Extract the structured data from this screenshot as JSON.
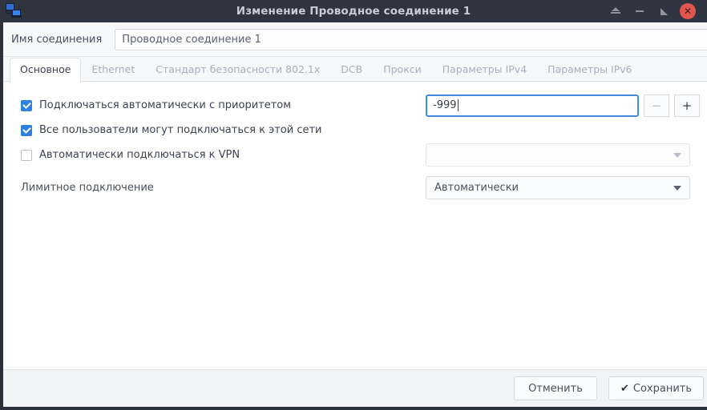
{
  "window": {
    "title": "Изменение Проводное соединение 1",
    "icon": "network-connection-icon",
    "controls": {
      "shade": "shade-icon",
      "minimize": "minimize-icon",
      "maximize": "maximize-icon",
      "close": "✕"
    }
  },
  "name_field": {
    "label": "Имя соединения",
    "value": "Проводное соединение 1",
    "placeholder": "Имя соединения"
  },
  "tabs": [
    {
      "label": "Основное",
      "active": true
    },
    {
      "label": "Ethernet",
      "active": false
    },
    {
      "label": "Стандарт безопасности 802.1x",
      "active": false
    },
    {
      "label": "DCB",
      "active": false
    },
    {
      "label": "Прокси",
      "active": false
    },
    {
      "label": "Параметры IPv4",
      "active": false
    },
    {
      "label": "Параметры IPv6",
      "active": false
    }
  ],
  "form": {
    "autoconnect": {
      "label": "Подключаться автоматически с приоритетом",
      "checked": true,
      "priority_value": "-999",
      "minus_label": "−",
      "plus_label": "+"
    },
    "all_users": {
      "label": "Все пользователи могут подключаться к этой сети",
      "checked": true
    },
    "auto_vpn": {
      "label": "Автоматически подключаться к VPN",
      "checked": false,
      "vpn_value": "",
      "vpn_placeholder": ""
    },
    "metered": {
      "label": "Лимитное подключение",
      "value": "Автоматически"
    }
  },
  "actions": {
    "cancel": "Отменить",
    "save": "Сохранить",
    "save_glyph": "✔"
  },
  "colors": {
    "titlebar": "#2f3441",
    "accent": "#2f7fe0",
    "focus_border": "#3f8ae0",
    "close_button": "#e2564f",
    "panel_bg": "#ffffff"
  }
}
